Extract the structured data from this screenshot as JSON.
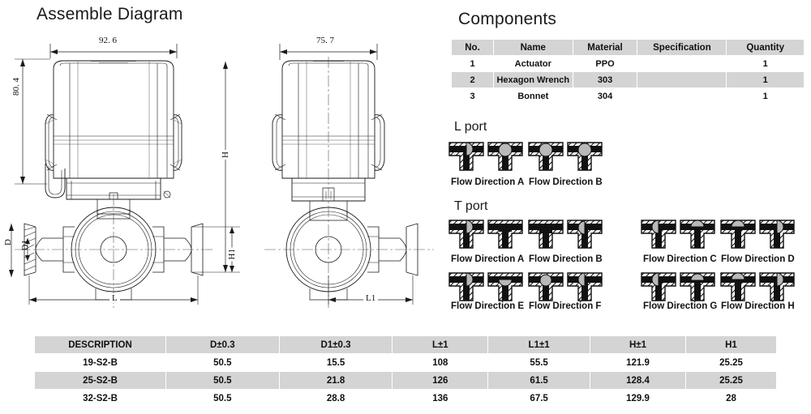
{
  "page": {
    "assemble_title": "Assemble Diagram",
    "components_title": "Components",
    "bg_color": "#ffffff",
    "line_color": "#1a1a1a",
    "table_header_color": "#d4d4d4"
  },
  "drawing": {
    "front_view": {
      "width_dim": "92. 6",
      "height_dim": "80. 4",
      "total_height_label": "H",
      "valve_height_label": "H1",
      "length_label": "L",
      "outer_dia_label": "D",
      "inner_dia_label": "D1"
    },
    "side_view": {
      "width_dim": "75. 7",
      "length_label": "L1"
    }
  },
  "components_table": {
    "headers": [
      "No.",
      "Name",
      "Material",
      "Specification",
      "Quantity"
    ],
    "rows": [
      {
        "no": "1",
        "name": "Actuator",
        "material": "PPO",
        "specification": "",
        "quantity": "1"
      },
      {
        "no": "2",
        "name": "Hexagon Wrench",
        "material": "303",
        "specification": "",
        "quantity": "1"
      },
      {
        "no": "3",
        "name": "Bonnet",
        "material": "304",
        "specification": "",
        "quantity": "1"
      }
    ]
  },
  "l_port": {
    "title": "L port",
    "groups": [
      {
        "label": "Flow Direction A"
      },
      {
        "label": "Flow Direction B"
      }
    ]
  },
  "t_port": {
    "title": "T port",
    "row1": [
      {
        "label": "Flow Direction A"
      },
      {
        "label": "Flow Direction B"
      },
      {
        "label": "Flow Direction C"
      },
      {
        "label": "Flow Direction D"
      }
    ],
    "row2": [
      {
        "label": "Flow Direction E"
      },
      {
        "label": "Flow Direction F"
      },
      {
        "label": "Flow Direction G"
      },
      {
        "label": "Flow Direction H"
      }
    ]
  },
  "spec_table": {
    "headers": [
      "DESCRIPTION",
      "D±0.3",
      "D1±0.3",
      "L±1",
      "L1±1",
      "H±1",
      "H1"
    ],
    "rows": [
      {
        "description": "19-S2-B",
        "d": "50.5",
        "d1": "15.5",
        "l": "108",
        "l1": "55.5",
        "h": "121.9",
        "h1": "25.25"
      },
      {
        "description": "25-S2-B",
        "d": "50.5",
        "d1": "21.8",
        "l": "126",
        "l1": "61.5",
        "h": "128.4",
        "h1": "25.25"
      },
      {
        "description": "32-S2-B",
        "d": "50.5",
        "d1": "28.8",
        "l": "136",
        "l1": "67.5",
        "h": "129.9",
        "h1": "28"
      }
    ]
  }
}
